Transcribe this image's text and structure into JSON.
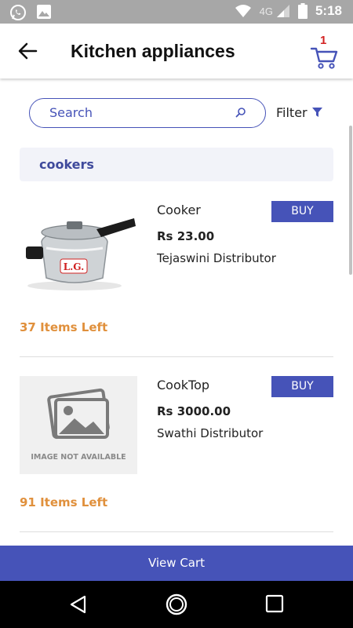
{
  "status_bar": {
    "time": "5:18",
    "network": "4G",
    "icons": [
      "whatsapp-icon",
      "image-icon",
      "wifi-icon",
      "signal-icon",
      "battery-icon"
    ]
  },
  "appbar": {
    "title": "Kitchen appliances",
    "cart_count": "1",
    "icons": [
      "back-arrow-icon",
      "cart-icon"
    ]
  },
  "search": {
    "placeholder": "Search",
    "filter_label": "Filter"
  },
  "category": {
    "label": "cookers"
  },
  "products": [
    {
      "name": "Cooker",
      "price": "Rs 23.00",
      "distributor": "Tejaswini Distributor",
      "buy_label": "BUY",
      "items_left": "37  Items Left",
      "image": "pressure-cooker-photo",
      "image_brand": "L.G."
    },
    {
      "name": "CookTop",
      "price": "Rs 3000.00",
      "distributor": "Swathi Distributor",
      "buy_label": "BUY",
      "items_left": "91  Items Left",
      "image": "image-placeholder",
      "image_text": "IMAGE NOT AVAILABLE"
    }
  ],
  "footer": {
    "view_cart_label": "View Cart"
  },
  "colors": {
    "accent": "#4653b8",
    "stock": "#e0903c",
    "cart_badge": "#d32222",
    "category_bg": "#f2f3f9"
  }
}
